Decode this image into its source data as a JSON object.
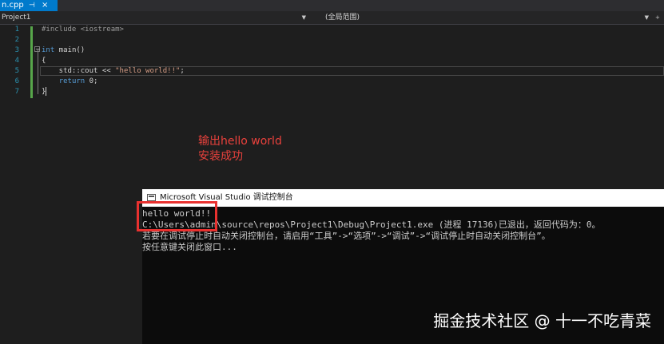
{
  "editor": {
    "tab": {
      "filename": "n.cpp",
      "pin_glyph": "⊣",
      "close_glyph": "×"
    },
    "nav": {
      "project": "Project1",
      "scope": "(全局范围)"
    },
    "line_numbers": [
      "1",
      "2",
      "3",
      "4",
      "5",
      "6",
      "7"
    ],
    "code_lines": [
      {
        "parts": [
          {
            "t": "#include <iostream>",
            "c": "pp"
          }
        ]
      },
      {
        "parts": []
      },
      {
        "parts": [
          {
            "t": "int",
            "c": "kw"
          },
          {
            "t": " main()",
            "c": ""
          }
        ]
      },
      {
        "parts": [
          {
            "t": "{",
            "c": ""
          }
        ]
      },
      {
        "parts": [
          {
            "t": "    std::cout << ",
            "c": ""
          },
          {
            "t": "\"hello world!!\"",
            "c": "str"
          },
          {
            "t": ";",
            "c": ""
          }
        ]
      },
      {
        "parts": [
          {
            "t": "    ",
            "c": ""
          },
          {
            "t": "return",
            "c": "kw"
          },
          {
            "t": " 0;",
            "c": ""
          }
        ]
      },
      {
        "parts": [
          {
            "t": "}",
            "c": ""
          }
        ]
      }
    ]
  },
  "annotation": {
    "line1": "输出hello world",
    "line2": "安装成功"
  },
  "console": {
    "title": "Microsoft Visual Studio 调试控制台",
    "lines": [
      "hello world!!",
      "C:\\Users\\admin\\source\\repos\\Project1\\Debug\\Project1.exe (进程 17136)已退出，返回代码为：0。",
      "若要在调试停止时自动关闭控制台，请启用“工具”->“选项”->“调试”->“调试停止时自动关闭控制台”。",
      "按任意键关闭此窗口..."
    ]
  },
  "watermark": "掘金技术社区 @ 十一不吃青菜",
  "colors": {
    "editor_bg": "#1e1e1e",
    "tab_active": "#007acc",
    "keyword": "#569cd6",
    "string": "#d69d85",
    "annotation_red": "#e8413c",
    "highlight_box": "#e8312f",
    "console_bg": "#0c0c0c"
  }
}
